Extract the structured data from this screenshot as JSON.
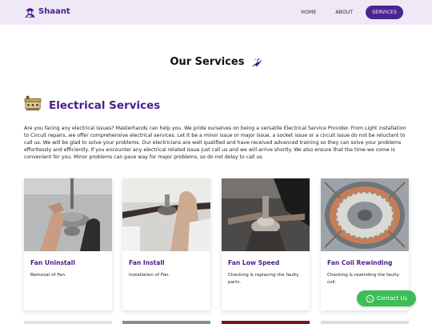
{
  "brand": {
    "name": "Shaant",
    "accent": "#4a1e8c",
    "nav_bg": "#efe9f6"
  },
  "nav": {
    "items": [
      {
        "label": "HOME",
        "active": false
      },
      {
        "label": "ABOUT",
        "active": false
      },
      {
        "label": "SERVICES",
        "active": true
      }
    ]
  },
  "page": {
    "title": "Our Services",
    "title_icon": "plug-icon"
  },
  "section": {
    "icon": "electric-panel-icon",
    "title": "Electrical Services",
    "intro": "Are you facing any electrical issues? Masterhands can help you. We pride ourselves on being a versatile Electrical Service Provider. From Light installation to Circuit repairs, we offer comprehensive electrical services. Let it be a minor issue or major issue, a socket issue or a circuit issue do not be reluctant to call us. We will be glad to solve your problems. Our electricians are well qualified and have received advanced training so they can solve your problems effortlessly and efficiently. If you encounter any electrical related issue just call us and we will arrive shortly. We also ensure that the time we come is convenient for you. Minor problems can pave way for major problems, so do not delay to call us."
  },
  "cards": [
    {
      "title": "Fan Uninstall",
      "desc": "Removal of Fan."
    },
    {
      "title": "Fan Install",
      "desc": "Installation of Fan."
    },
    {
      "title": "Fan Low Speed",
      "desc": "Checking & replacing the faulty parts."
    },
    {
      "title": "Fan Coil Rewinding",
      "desc": "Checking & rewinding the faulty coil."
    }
  ],
  "contact": {
    "label": "Contact Us",
    "icon": "whatsapp-icon",
    "color": "#3ebc58"
  }
}
